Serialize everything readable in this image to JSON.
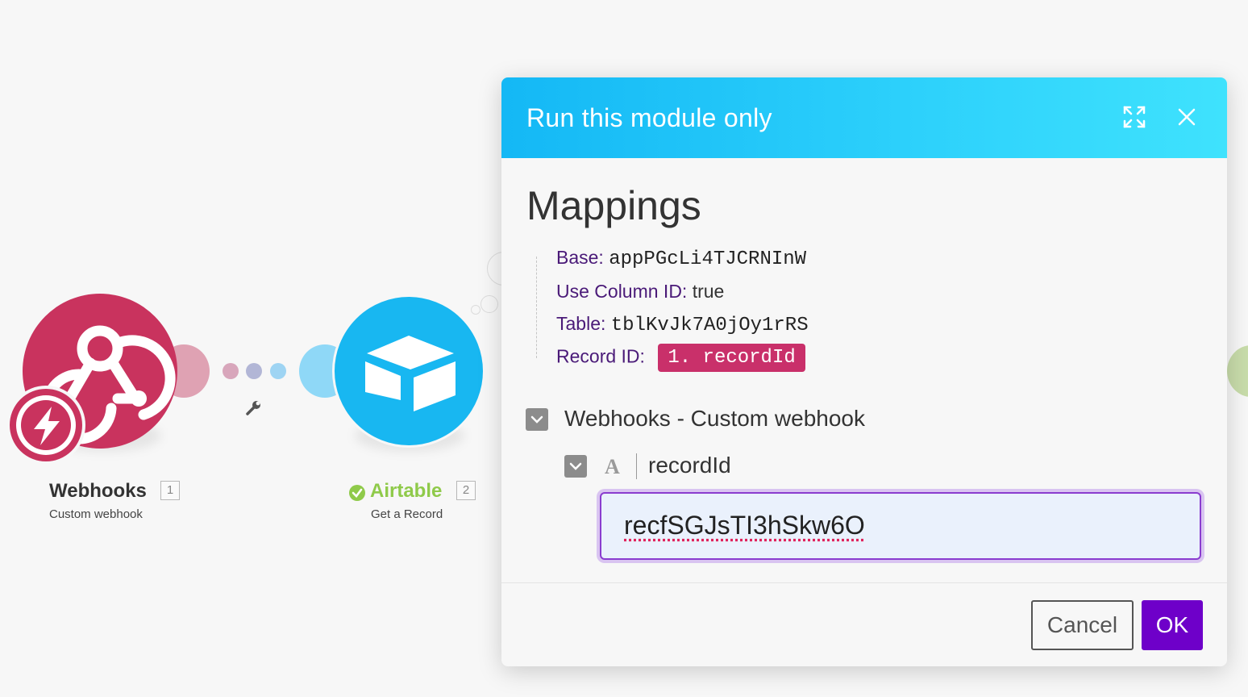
{
  "modules": [
    {
      "name": "Webhooks",
      "number": "1",
      "subtitle": "Custom webhook",
      "color": "#c9335e",
      "icon": "webhook-icon",
      "badge": "instant-trigger-icon"
    },
    {
      "name": "Airtable",
      "number": "2",
      "subtitle": "Get a Record",
      "color": "#18b7f1",
      "name_color": "#8fca4a",
      "icon": "airtable-icon",
      "status": "success-check-icon"
    }
  ],
  "dialog": {
    "title": "Run this module only",
    "header_colors": [
      "#14b8f5",
      "#3fe2fd"
    ],
    "expand_icon": "expand-icon",
    "close_icon": "close-icon",
    "section_title": "Mappings",
    "mappings": {
      "base_label": "Base:",
      "base_value": "appPGcLi4TJCRNInW",
      "use_column_label": "Use Column ID:",
      "use_column_value": "true",
      "table_label": "Table:",
      "table_value": "tblKvJk7A0jOy1rRS",
      "record_label": "Record ID:",
      "record_pill": "1. recordId"
    },
    "group": {
      "label": "Webhooks - Custom webhook",
      "field_type": "A",
      "field_name": "recordId",
      "field_value": "recfSGJsTI3hSkw6O"
    },
    "buttons": {
      "cancel": "Cancel",
      "ok": "OK"
    },
    "ok_color": "#6e00c9",
    "pill_color": "#c9306a"
  }
}
